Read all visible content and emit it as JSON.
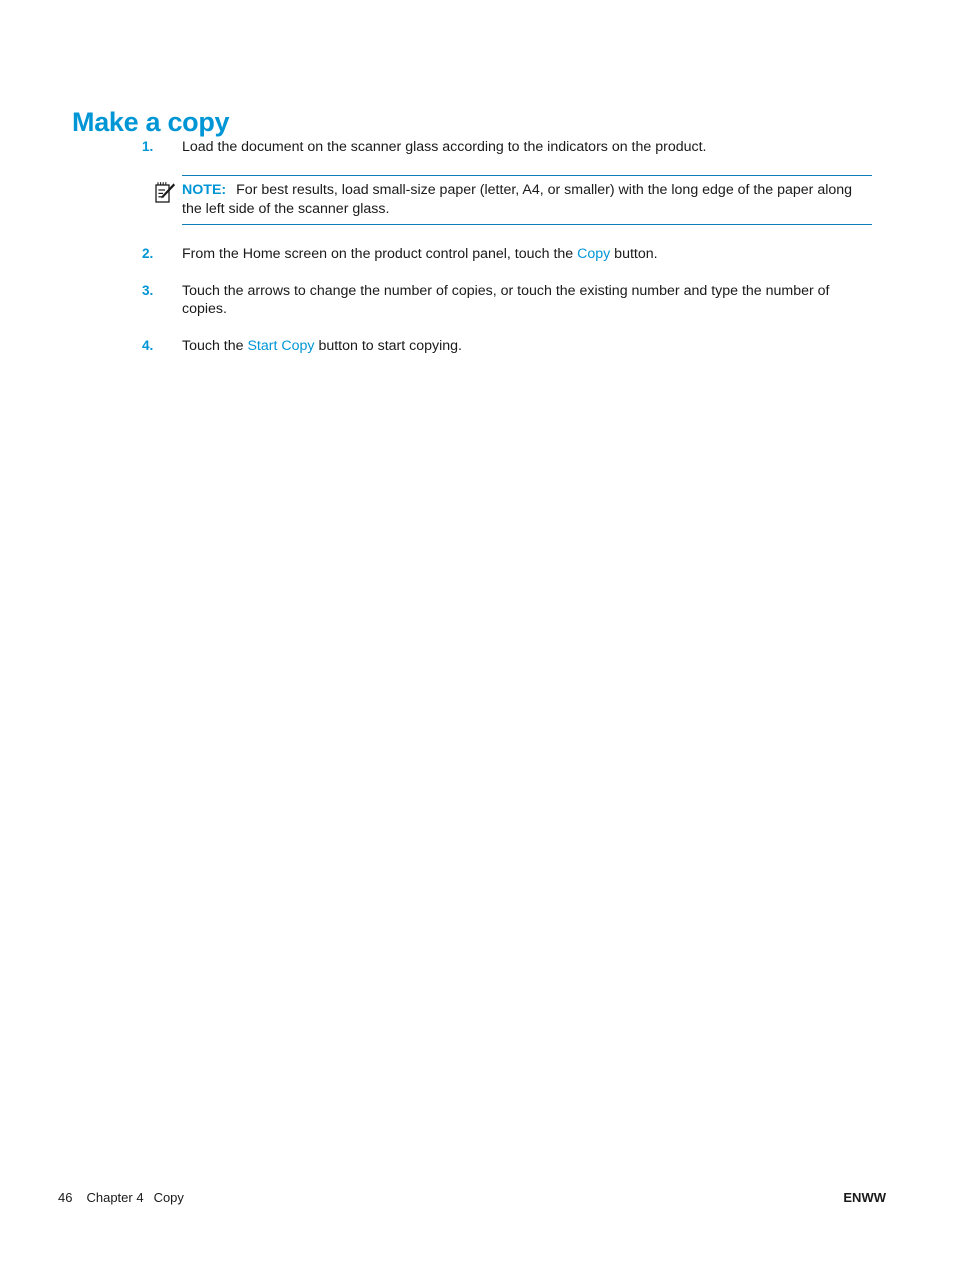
{
  "document": {
    "heading": "Make a copy",
    "accent_color": "#0096d6",
    "rule_color": "#0f7fba"
  },
  "steps": [
    {
      "number": "1.",
      "text": "Load the document on the scanner glass according to the indicators on the product."
    },
    {
      "number": "2.",
      "text_before": "From the Home screen on the product control panel, touch the ",
      "ui_term": "Copy",
      "text_after": " button."
    },
    {
      "number": "3.",
      "text": "Touch the arrows to change the number of copies, or touch the existing number and type the number of copies."
    },
    {
      "number": "4.",
      "text_before": "Touch the ",
      "ui_term": "Start Copy",
      "text_after": " button to start copying."
    }
  ],
  "note": {
    "icon": "note-pencil-icon",
    "label": "NOTE:",
    "text": "For best results, load small-size paper (letter, A4, or smaller) with the long edge of the paper along the left side of the scanner glass."
  },
  "footer": {
    "page_number": "46",
    "chapter": "Chapter 4",
    "section": "Copy",
    "right": "ENWW"
  }
}
